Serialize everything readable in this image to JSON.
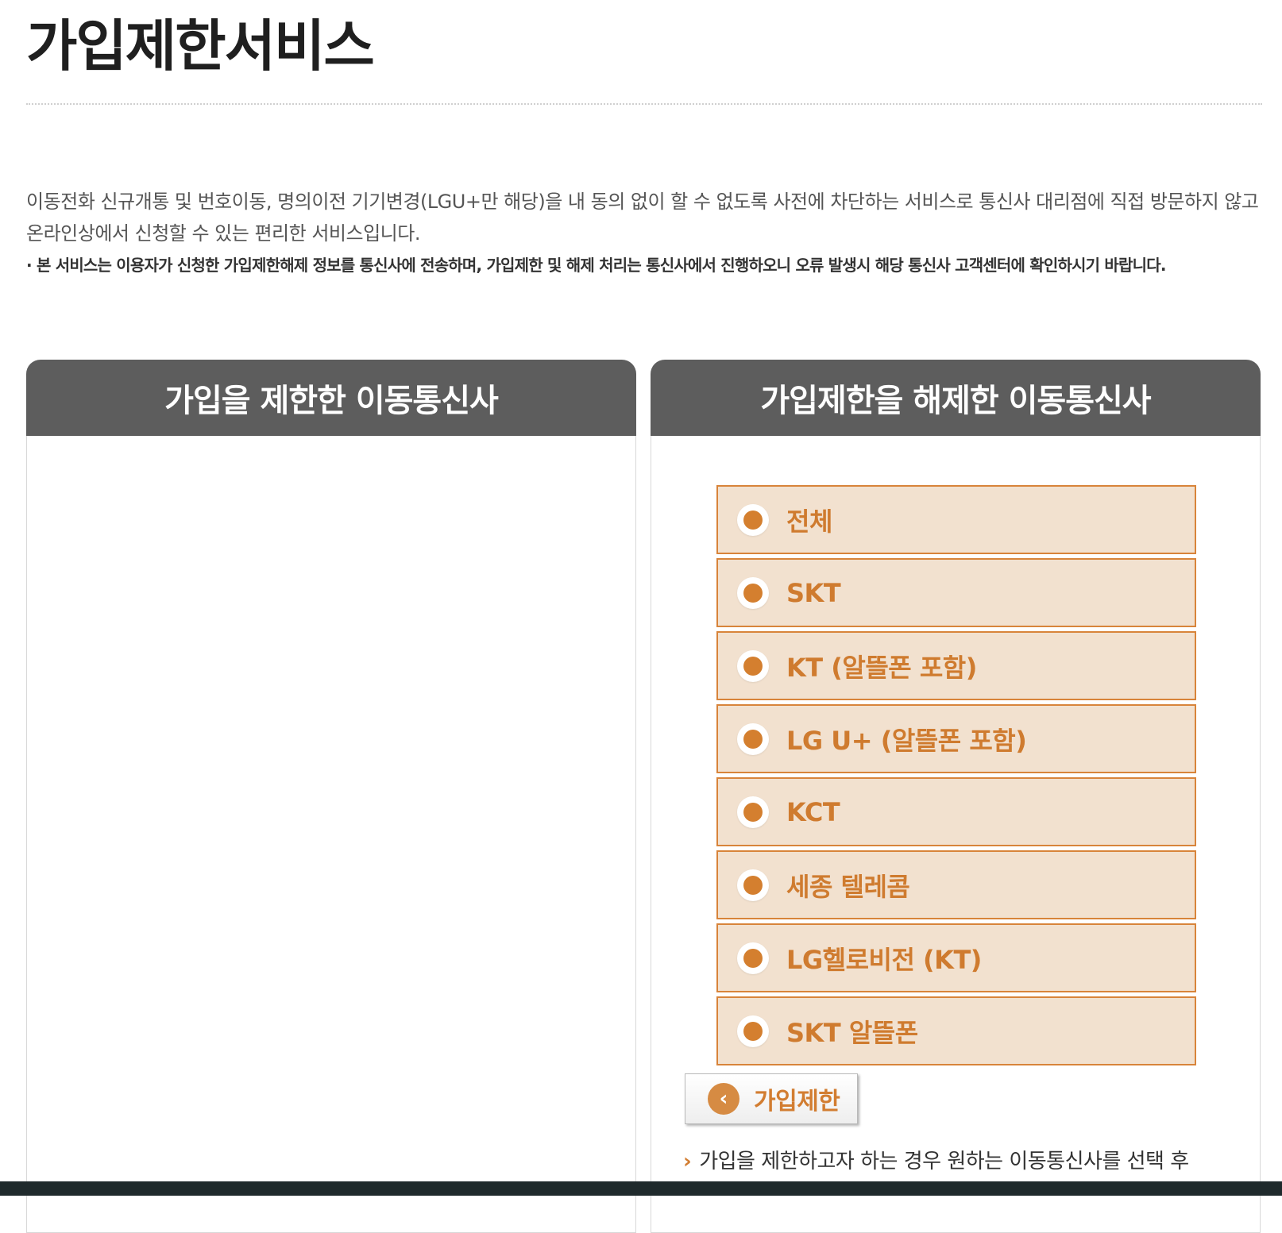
{
  "page": {
    "title": "가입제한서비스"
  },
  "description": {
    "text": "이동전화 신규개통 및 번호이동, 명의이전 기기변경(LGU+만 해당)을 내 동의 없이 할 수 없도록 사전에 차단하는 서비스로 통신사 대리점에 직접 방문하지 않고 온라인상에서 신청할 수 있는 편리한 서비스입니다.",
    "note": "· 본 서비스는 이용자가 신청한 가입제한해제 정보를 통신사에 전송하며, 가입제한 및 해제 처리는 통신사에서 진행하오니 오류 발생시 해당 통신사 고객센터에 확인하시기 바랍니다."
  },
  "left_panel": {
    "title": "가입을 제한한 이동통신사"
  },
  "right_panel": {
    "title": "가입제한을 해제한 이동통신사",
    "carriers": [
      {
        "label": "전체"
      },
      {
        "label": "SKT"
      },
      {
        "label": "KT (알뜰폰 포함)"
      },
      {
        "label": "LG U+ (알뜰폰 포함)"
      },
      {
        "label": "KCT"
      },
      {
        "label": "세종 텔레콤"
      },
      {
        "label": "LG헬로비전 (KT)"
      },
      {
        "label": "SKT 알뜰폰"
      }
    ],
    "button": {
      "icon": "chevron-left-icon",
      "label": "가입제한"
    },
    "guide": {
      "arrow": "›",
      "text": "가입을 제한하고자 하는 경우 원하는 이동통신사를 선택 후"
    }
  },
  "colors": {
    "header_bg": "#5d5d5d",
    "item_bg": "#f2e1cf",
    "item_border": "#d8843a",
    "accent": "#d47f2f"
  }
}
